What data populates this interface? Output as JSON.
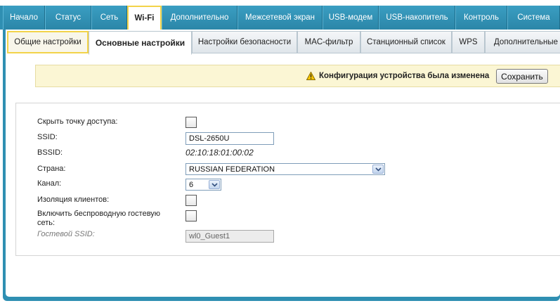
{
  "topnav": {
    "tabs": [
      {
        "label": "Начало"
      },
      {
        "label": "Статус"
      },
      {
        "label": "Сеть"
      },
      {
        "label": "Wi-Fi",
        "active": true
      },
      {
        "label": "Дополнительно"
      },
      {
        "label": "Межсетевой экран"
      },
      {
        "label": "USB-модем"
      },
      {
        "label": "USB-накопитель"
      },
      {
        "label": "Контроль"
      },
      {
        "label": "Система"
      }
    ]
  },
  "subtabs": [
    {
      "label": "Общие настройки"
    },
    {
      "label": "Основные настройки"
    },
    {
      "label": "Настройки безопасности"
    },
    {
      "label": "MAC-фильтр"
    },
    {
      "label": "Станционный список"
    },
    {
      "label": "WPS"
    },
    {
      "label": "Дополнительные н"
    }
  ],
  "notice": {
    "icon": "warning-icon",
    "text": "Конфигурация устройства была изменена",
    "save_label": "Сохранить"
  },
  "form": {
    "hide_ap_label": "Скрыть точку доступа:",
    "hide_ap_checked": false,
    "ssid_label": "SSID:",
    "ssid_value": "DSL-2650U",
    "bssid_label": "BSSID:",
    "bssid_value": "02:10:18:01:00:02",
    "country_label": "Страна:",
    "country_value": "RUSSIAN FEDERATION",
    "channel_label": "Канал:",
    "channel_value": "6",
    "client_isolation_label": "Изоляция клиентов:",
    "client_isolation_checked": false,
    "guest_network_label_line1": "Включить беспроводную гостевую",
    "guest_network_label_line2": "сеть:",
    "guest_network_checked": false,
    "guest_ssid_label": "Гостевой SSID:",
    "guest_ssid_value": "wl0_Guest1"
  },
  "colors": {
    "nav_blue": "#2f8fb2",
    "highlight_yellow": "#f2d34a",
    "notice_bg": "#fbf6d4"
  }
}
